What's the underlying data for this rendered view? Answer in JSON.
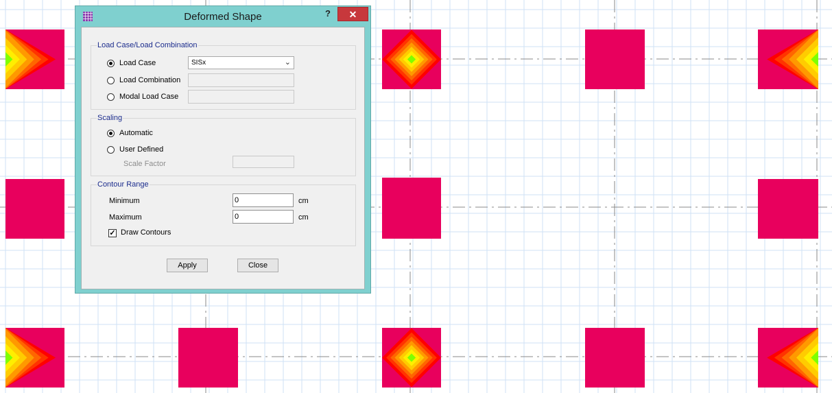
{
  "colors": {
    "column_fill": "#e8005d",
    "contour_scale": [
      "#e8005d",
      "#ff0000",
      "#ff3300",
      "#ff6600",
      "#ff9900",
      "#ffcc00",
      "#ffee00",
      "#7fff00"
    ],
    "grid_line": "#cfe2f5",
    "axis_line": "#888888",
    "dialog_frame": "#7fd0cf",
    "close_button": "#c7383c"
  },
  "dialog": {
    "icon": "grid-icon",
    "title": "Deformed Shape",
    "help": "?",
    "close": "✕",
    "load_group": {
      "title": "Load Case/Load Combination",
      "options": [
        "Load Case",
        "Load Combination",
        "Modal Load Case"
      ],
      "selected_index": 0,
      "load_case_value": "SISx",
      "combination_value": "",
      "modal_value": ""
    },
    "scaling_group": {
      "title": "Scaling",
      "options": [
        "Automatic",
        "User Defined"
      ],
      "selected_index": 0,
      "scale_factor_label": "Scale Factor",
      "scale_factor_value": ""
    },
    "contour_group": {
      "title": "Contour Range",
      "minimum_label": "Minimum",
      "minimum_value": "0",
      "maximum_label": "Maximum",
      "maximum_value": "0",
      "unit": "cm",
      "draw_contours_label": "Draw Contours",
      "draw_contours_checked": true
    },
    "apply_label": "Apply",
    "close_label": "Close"
  }
}
